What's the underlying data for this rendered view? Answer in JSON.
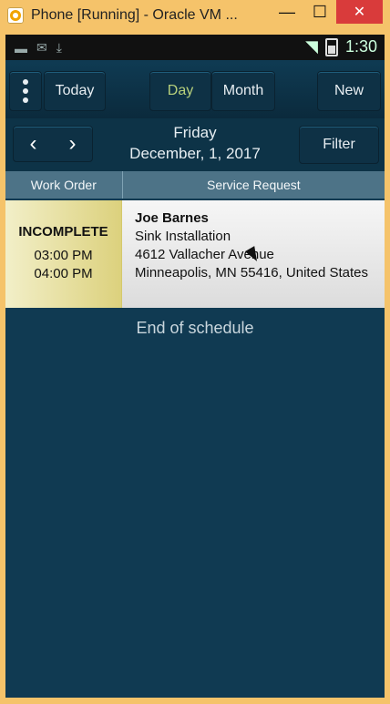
{
  "window": {
    "title": "Phone [Running] - Oracle VM ...",
    "close_label": "✕"
  },
  "statusbar": {
    "time": "1:30"
  },
  "toolbar": {
    "today_label": "Today",
    "day_label": "Day",
    "month_label": "Month",
    "new_label": "New"
  },
  "date": {
    "weekday": "Friday",
    "full": "December, 1, 2017",
    "filter_label": "Filter"
  },
  "columns": {
    "work_order": "Work Order",
    "service_request": "Service Request"
  },
  "orders": [
    {
      "status": "INCOMPLETE",
      "start_time": "03:00 PM",
      "end_time": "04:00 PM",
      "customer": "Joe Barnes",
      "service": "Sink Installation",
      "address_line1": "4612 Vallacher Avenue",
      "address_line2": "Minneapolis, MN 55416, United States"
    }
  ],
  "footer": {
    "end_text": "End of schedule"
  },
  "colors": {
    "window": "#f5c36a",
    "app_bg": "#103a52",
    "header_bg": "#4d7387",
    "close": "#d93b3b"
  }
}
